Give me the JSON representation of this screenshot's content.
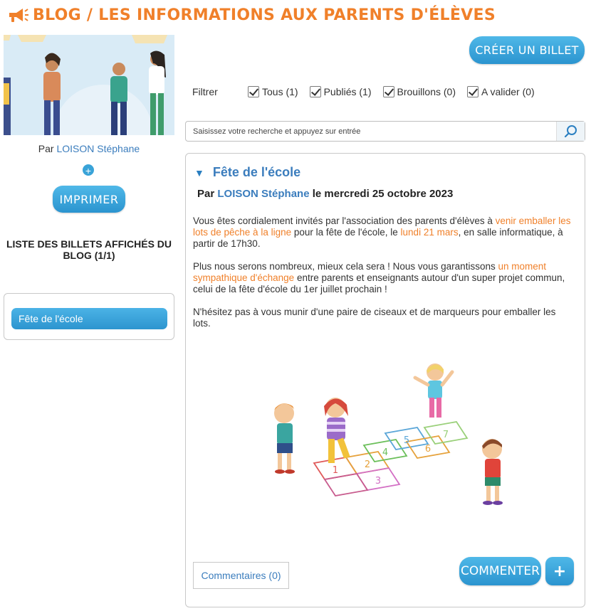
{
  "header": {
    "title": "BLOG / LES INFORMATIONS AUX PARENTS D'ÉLÈVES",
    "icon": "megaphone-icon",
    "accent_color": "#f0802a"
  },
  "sidebar": {
    "banner_author_prefix": "Par",
    "banner_author_name": "LOISON Stéphane",
    "banner_plus": "+",
    "print_label": "IMPRIMER",
    "list_title": "LISTE DES BILLETS AFFICHÉS DU BLOG (1/1)",
    "items": [
      {
        "label": "Fête de l'école"
      }
    ]
  },
  "toolbar": {
    "create_label": "CRÉER UN BILLET"
  },
  "filters": {
    "label": "Filtrer",
    "options": [
      {
        "label": "Tous (1)",
        "checked": true
      },
      {
        "label": "Publiés (1)",
        "checked": true
      },
      {
        "label": "Brouillons (0)",
        "checked": true
      },
      {
        "label": "A valider (0)",
        "checked": true
      }
    ]
  },
  "search": {
    "placeholder": "Saisissez votre recherche et appuyez sur entrée",
    "icon": "search-icon"
  },
  "post": {
    "title": "Fête de l'école",
    "meta_prefix": "Par",
    "author": "LOISON Stéphane",
    "meta_suffix": "le mercredi 25 octobre 2023",
    "p1_a": "Vous êtes cordialement invités par l'association des parents d'élèves à ",
    "p1_hl1": "venir emballer les lots de pêche à la ligne",
    "p1_b": " pour la fête de l'école, le ",
    "p1_hl2": "lundi 21 mars",
    "p1_c": ", en salle informatique, à partir de 17h30.",
    "p2_a": "Plus nous serons nombreux, mieux cela sera ! Nous vous garantissons ",
    "p2_hl": "un moment sympathique d'échange",
    "p2_b": " entre parents et enseignants autour d'un super projet commun, celui de la fête d'école du 1er juillet prochain !",
    "p3": "N'hésitez pas à vous munir d'une paire de ciseaux et de marqueurs pour emballer les lots.",
    "comments_label": "Commentaires (0)",
    "comment_button": "COMMENTER",
    "add_button": "+",
    "highlight_color": "#f0802a",
    "link_color": "#3b7dbd"
  },
  "illustration": {
    "hopscotch_numbers": [
      "1",
      "2",
      "3",
      "4",
      "5",
      "6",
      "7"
    ]
  }
}
